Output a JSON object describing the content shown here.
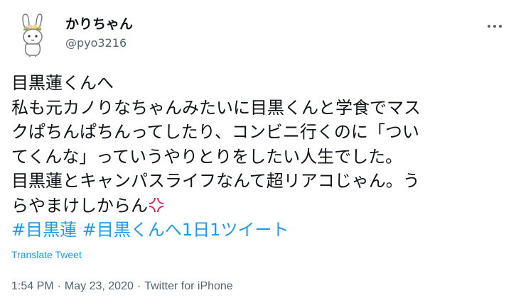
{
  "author": {
    "display_name": "かりちゃん",
    "handle": "@pyo3216"
  },
  "tweet": {
    "lines": [
      "目黒蓮くんへ",
      "私も元カノりなちゃんみたいに目黒くんと学食でマス",
      "クぱちんぱちんってしたり、コンビニ行くのに「つい",
      "てくんな」っていうやりとりをしたい人生でした。",
      "目黒蓮とキャンパスライフなんて超リアコじゃん。う",
      "らやまけしからん"
    ],
    "hashtags": [
      "#目黒蓮",
      "#目黒くんへ1日1ツイート"
    ]
  },
  "translate_label": "Translate Tweet",
  "meta": {
    "time": "1:54 PM",
    "date": "May 23, 2020",
    "separator": "·",
    "source": "Twitter for iPhone"
  },
  "colors": {
    "link": "#1d9bf0",
    "secondary": "#536471",
    "anger_emoji": "#e0245e"
  },
  "icons": {
    "more": "more-dots-icon",
    "emoji": "anger-symbol-icon"
  }
}
